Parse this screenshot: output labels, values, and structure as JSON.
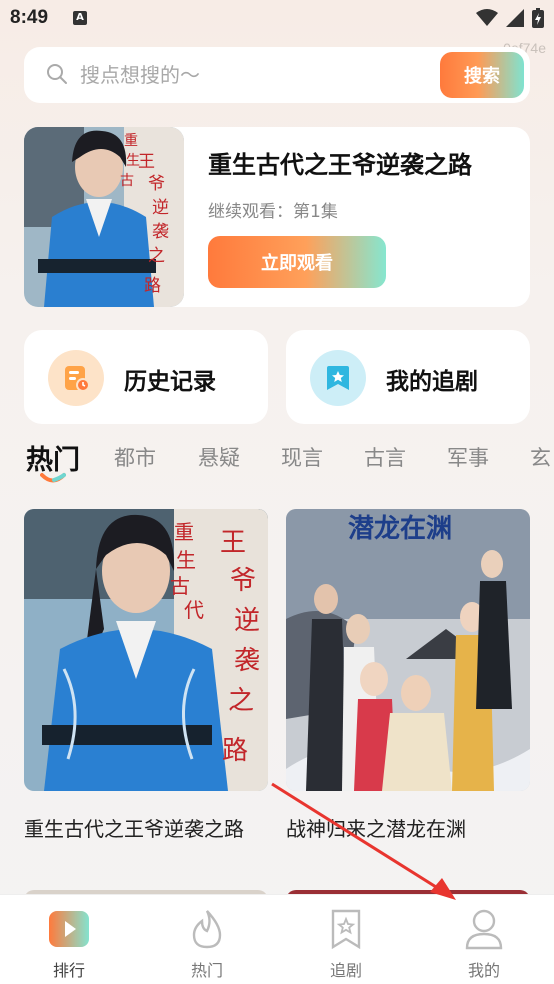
{
  "status_bar": {
    "time": "8:49",
    "notif": "A"
  },
  "watermark": "0ef74e",
  "search": {
    "placeholder": "搜点想搜的～",
    "button_label": "搜索"
  },
  "continue_card": {
    "title": "重生古代之王爷逆袭之路",
    "progress": "继续观看：第1集",
    "button_label": "立即观看"
  },
  "quick_links": {
    "history_label": "历史记录",
    "follow_label": "我的追剧"
  },
  "tabs": [
    "热门",
    "都市",
    "悬疑",
    "现言",
    "古言",
    "军事",
    "玄"
  ],
  "dramas": [
    {
      "title": "重生古代之王爷逆袭之路",
      "poster_text": "重生古代之王爷逆袭之路"
    },
    {
      "title": "战神归来之潜龙在渊",
      "poster_text": "潜龙在渊"
    }
  ],
  "bottom_nav": [
    {
      "label": "排行"
    },
    {
      "label": "热门"
    },
    {
      "label": "追剧"
    },
    {
      "label": "我的"
    }
  ],
  "colors": {
    "accent_orange": "#ff7a3c",
    "accent_teal": "#7fe3d0",
    "arrow_red": "#e8352f"
  }
}
